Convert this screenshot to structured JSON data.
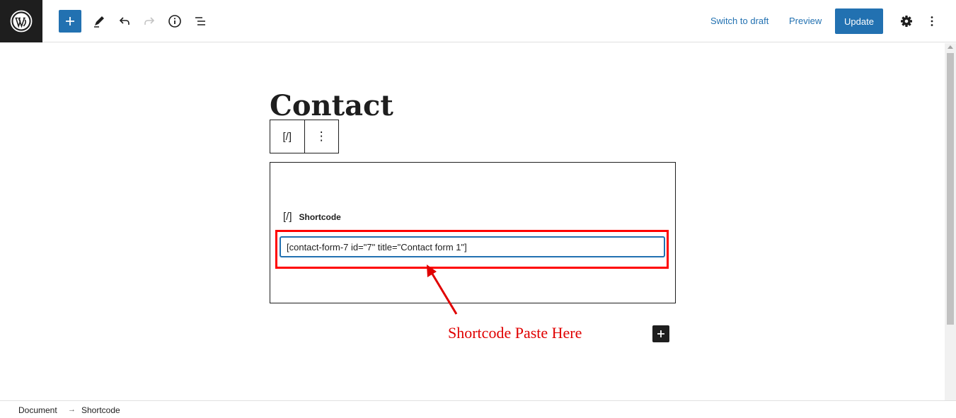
{
  "toolbar": {
    "switch_to_draft": "Switch to draft",
    "preview": "Preview",
    "update": "Update"
  },
  "editor": {
    "title": "Contact",
    "block_toolbar": {
      "block_icon_glyph": "[/]",
      "more_glyph": "⋮"
    },
    "shortcode_block": {
      "label_glyph": "[/]",
      "label": "Shortcode",
      "value": "[contact-form-7 id=\"7\" title=\"Contact form 1\"]"
    }
  },
  "annotation": {
    "text": "Shortcode Paste Here",
    "color": "#e00000"
  },
  "breadcrumb": {
    "items": [
      "Document",
      "Shortcode"
    ],
    "separator": "→"
  },
  "colors": {
    "accent": "#2271b1",
    "highlight": "#ff0000",
    "dark": "#1e1e1e"
  }
}
